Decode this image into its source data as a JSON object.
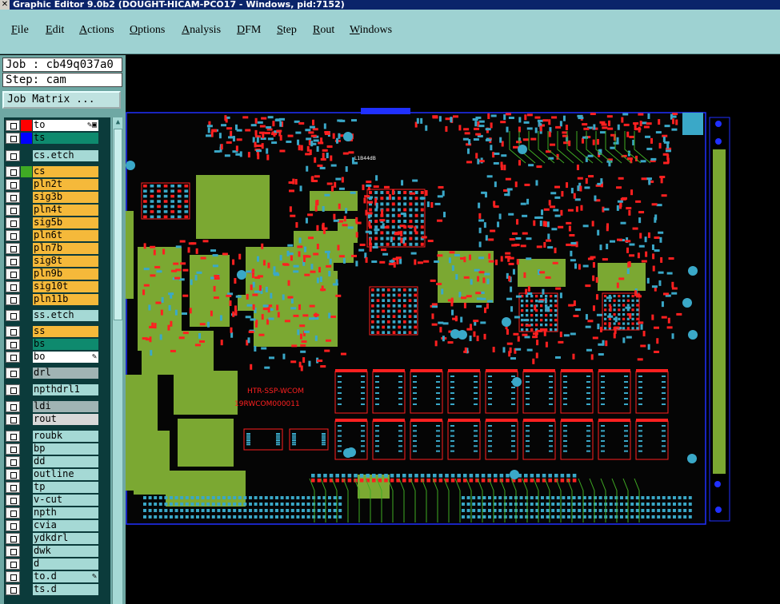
{
  "window": {
    "title": "Graphic Editor 9.0b2 (DOUGHT-HICAM-PCO17 - Windows, pid:7152)"
  },
  "menu": [
    "File",
    "Edit",
    "Actions",
    "Options",
    "Analysis",
    "DFM",
    "Step",
    "Rout",
    "Windows"
  ],
  "job": {
    "job_label": "Job : cb49q037a0",
    "step_label": "Step: cam",
    "matrix_button": "Job Matrix ..."
  },
  "layers": [
    {
      "name": "to",
      "swatch": "#ff0000",
      "bg": "#ffffff",
      "checked": true,
      "mark": "✎▣"
    },
    {
      "name": "ts",
      "swatch": "#0000ff",
      "bg": "#0e8a6e",
      "checked": true,
      "mark": ""
    },
    {
      "name": "cs.etch",
      "swatch": "",
      "bg": "#a5d9d5",
      "checked": false,
      "mark": ""
    },
    {
      "name": "cs",
      "swatch": "#3faa24",
      "bg": "#f5b93a",
      "checked": false,
      "mark": ""
    },
    {
      "name": "pln2t",
      "swatch": "",
      "bg": "#f5b93a",
      "checked": false,
      "mark": ""
    },
    {
      "name": "sig3b",
      "swatch": "",
      "bg": "#f5b93a",
      "checked": false,
      "mark": ""
    },
    {
      "name": "pln4t",
      "swatch": "",
      "bg": "#f5b93a",
      "checked": false,
      "mark": ""
    },
    {
      "name": "sig5b",
      "swatch": "",
      "bg": "#f5b93a",
      "checked": false,
      "mark": ""
    },
    {
      "name": "pln6t",
      "swatch": "",
      "bg": "#f5b93a",
      "checked": false,
      "mark": ""
    },
    {
      "name": "pln7b",
      "swatch": "",
      "bg": "#f5b93a",
      "checked": false,
      "mark": ""
    },
    {
      "name": "sig8t",
      "swatch": "",
      "bg": "#f5b93a",
      "checked": false,
      "mark": ""
    },
    {
      "name": "pln9b",
      "swatch": "",
      "bg": "#f5b93a",
      "checked": false,
      "mark": ""
    },
    {
      "name": "sig10t",
      "swatch": "",
      "bg": "#f5b93a",
      "checked": false,
      "mark": ""
    },
    {
      "name": "pln11b",
      "swatch": "",
      "bg": "#f5b93a",
      "checked": false,
      "mark": ""
    },
    {
      "name": "ss.etch",
      "swatch": "",
      "bg": "#a5d9d5",
      "checked": false,
      "mark": ""
    },
    {
      "name": "ss",
      "swatch": "",
      "bg": "#f5b93a",
      "checked": false,
      "mark": ""
    },
    {
      "name": "bs",
      "swatch": "",
      "bg": "#0e8a6e",
      "checked": false,
      "mark": ""
    },
    {
      "name": "bo",
      "swatch": "",
      "bg": "#ffffff",
      "checked": false,
      "mark": "✎"
    },
    {
      "name": "drl",
      "swatch": "",
      "bg": "#a0b4b4",
      "checked": false,
      "mark": ""
    },
    {
      "name": "npthdrl1",
      "swatch": "",
      "bg": "#a5d9d5",
      "checked": false,
      "mark": ""
    },
    {
      "name": "ldi",
      "swatch": "",
      "bg": "#a0b4b4",
      "checked": false,
      "mark": ""
    },
    {
      "name": "rout",
      "swatch": "",
      "bg": "#d8d8d8",
      "checked": false,
      "mark": ""
    },
    {
      "name": "roubk",
      "swatch": "",
      "bg": "#a5d9d5",
      "checked": false,
      "mark": ""
    },
    {
      "name": "bp",
      "swatch": "",
      "bg": "#a5d9d5",
      "checked": false,
      "mark": ""
    },
    {
      "name": "dd",
      "swatch": "",
      "bg": "#a5d9d5",
      "checked": false,
      "mark": ""
    },
    {
      "name": "outline",
      "swatch": "",
      "bg": "#a5d9d5",
      "checked": false,
      "mark": ""
    },
    {
      "name": "tp",
      "swatch": "",
      "bg": "#a5d9d5",
      "checked": false,
      "mark": ""
    },
    {
      "name": "v-cut",
      "swatch": "",
      "bg": "#a5d9d5",
      "checked": false,
      "mark": ""
    },
    {
      "name": "npth",
      "swatch": "",
      "bg": "#a5d9d5",
      "checked": false,
      "mark": ""
    },
    {
      "name": "cvia",
      "swatch": "",
      "bg": "#a5d9d5",
      "checked": false,
      "mark": ""
    },
    {
      "name": "ydkdrl",
      "swatch": "",
      "bg": "#a5d9d5",
      "checked": false,
      "mark": ""
    },
    {
      "name": "dwk",
      "swatch": "",
      "bg": "#a5d9d5",
      "checked": false,
      "mark": ""
    },
    {
      "name": "d",
      "swatch": "",
      "bg": "#a5d9d5",
      "checked": false,
      "mark": ""
    },
    {
      "name": "to.d",
      "swatch": "",
      "bg": "#a5d9d5",
      "checked": false,
      "mark": "✎"
    },
    {
      "name": "ts.d",
      "swatch": "",
      "bg": "#a5d9d5",
      "checked": false,
      "mark": ""
    }
  ],
  "board": {
    "silk_text_1": "HTR-SSP-WCOM",
    "silk_text_2": "19RWCOM000011",
    "silk_text_3": "L1B44dB"
  },
  "colors": {
    "copper": "#7ba832",
    "pad": "#ff2020",
    "smd": "#3aa8c8",
    "outline": "#2030ff",
    "trace": "#3faa24"
  }
}
